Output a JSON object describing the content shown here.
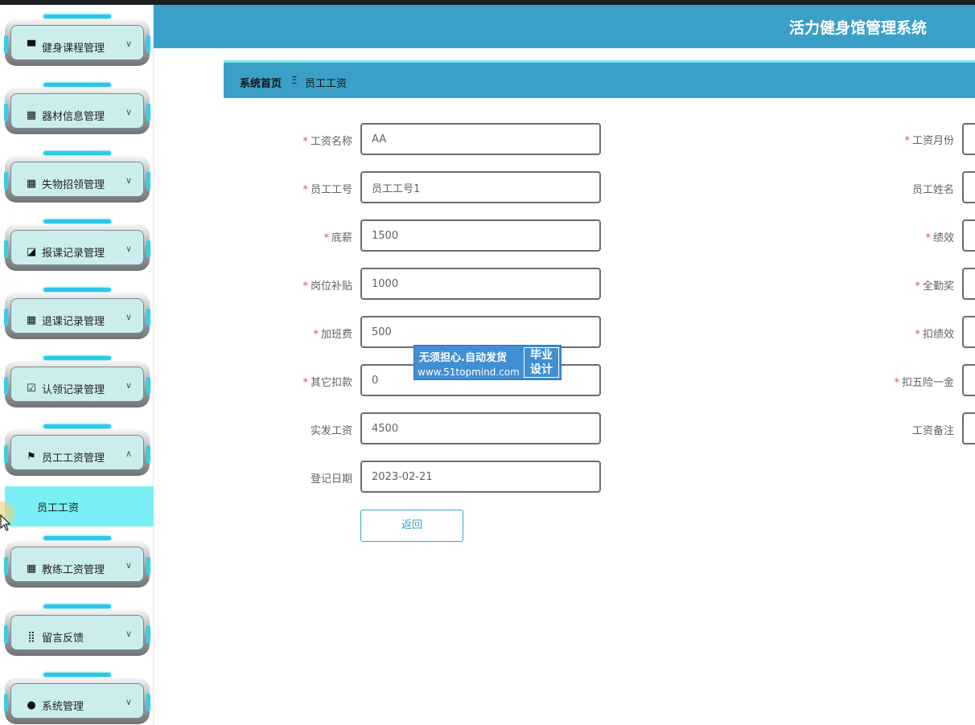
{
  "header": {
    "title": "活力健身馆管理系统"
  },
  "breadcrumb": {
    "home": "系统首页",
    "separator": "Ξ",
    "current": "员工工资"
  },
  "sidebar": {
    "items": [
      {
        "label": "健身课程管理",
        "icon": "monitor-icon",
        "glyph": "▀",
        "chevron": "∨"
      },
      {
        "label": "器材信息管理",
        "icon": "grid-icon",
        "glyph": "▦",
        "chevron": "∨"
      },
      {
        "label": "失物招领管理",
        "icon": "grid-icon",
        "glyph": "▦",
        "chevron": "∨"
      },
      {
        "label": "报课记录管理",
        "icon": "chart-icon",
        "glyph": "◪",
        "chevron": "∨"
      },
      {
        "label": "退课记录管理",
        "icon": "grid-icon",
        "glyph": "▦",
        "chevron": "∨"
      },
      {
        "label": "认领记录管理",
        "icon": "clipboard-check-icon",
        "glyph": "☑",
        "chevron": "∨"
      },
      {
        "label": "员工工资管理",
        "icon": "flag-icon",
        "glyph": "⚑",
        "chevron": "∧"
      },
      {
        "label": "教练工资管理",
        "icon": "grid-icon",
        "glyph": "▦",
        "chevron": "∨"
      },
      {
        "label": "留言反馈",
        "icon": "dots-grid-icon",
        "glyph": "⣿",
        "chevron": "∨"
      },
      {
        "label": "系统管理",
        "icon": "bulb-icon",
        "glyph": "●",
        "chevron": "∨"
      }
    ],
    "sub_item": "员工工资"
  },
  "form": {
    "left": [
      {
        "label": "工资名称",
        "required": "*",
        "value": "AA"
      },
      {
        "label": "员工工号",
        "required": "*",
        "value": "员工工号1"
      },
      {
        "label": "底薪",
        "required": "*",
        "value": "1500"
      },
      {
        "label": "岗位补贴",
        "required": "*",
        "value": "1000"
      },
      {
        "label": "加班费",
        "required": "*",
        "value": "500"
      },
      {
        "label": "其它扣款",
        "required": "*",
        "value": "0"
      },
      {
        "label": "实发工资",
        "required": "",
        "value": "4500"
      },
      {
        "label": "登记日期",
        "required": "",
        "value": "2023-02-21"
      }
    ],
    "right": [
      {
        "label": "工资月份",
        "required": "*"
      },
      {
        "label": "员工姓名",
        "required": ""
      },
      {
        "label": "绩效",
        "required": "*"
      },
      {
        "label": "全勤奖",
        "required": "*"
      },
      {
        "label": "扣绩效",
        "required": "*"
      },
      {
        "label": "扣五险一金",
        "required": "*"
      },
      {
        "label": "工资备注",
        "required": ""
      }
    ],
    "back_button": "返回"
  },
  "watermark": {
    "line1": "无须担心.自动发货",
    "line2": "www.51topmind.com",
    "right_line1": "毕业",
    "right_line2": "设计"
  }
}
